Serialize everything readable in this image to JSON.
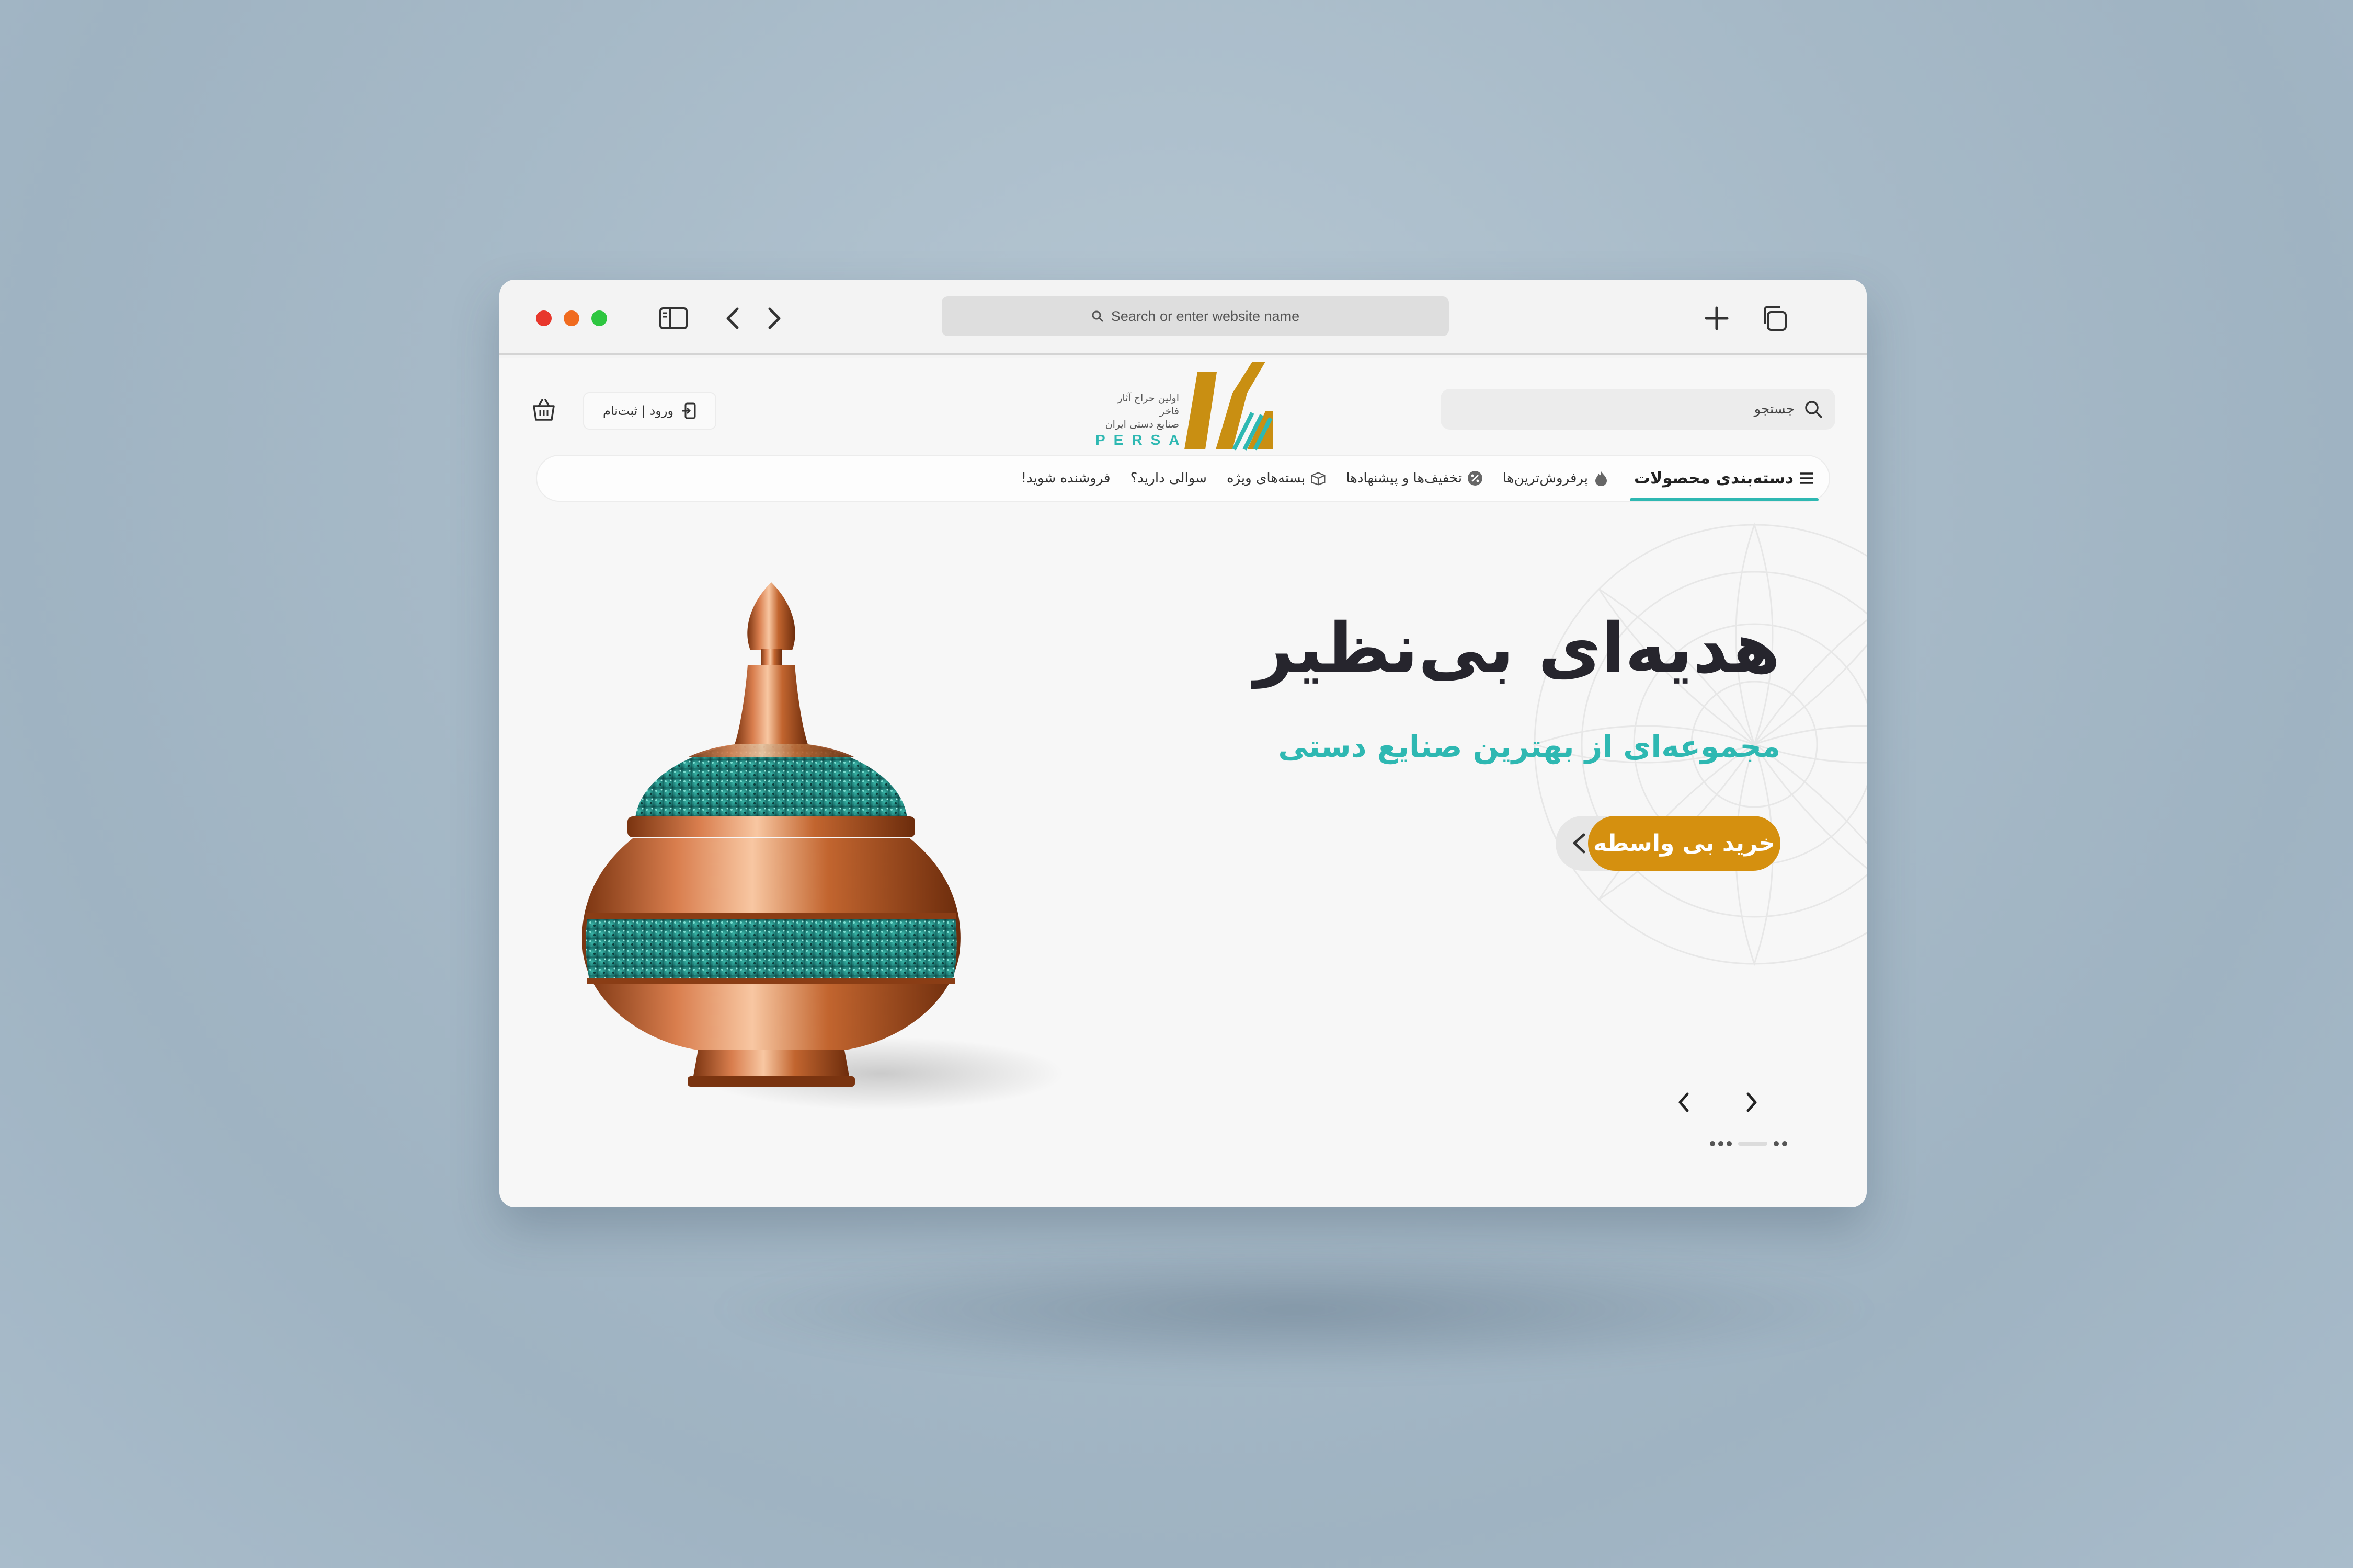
{
  "browser": {
    "url_placeholder": "Search or enter website name"
  },
  "header": {
    "login_label": "ورود | ثبت‌نام",
    "search_placeholder": "جستجو",
    "logo": {
      "tagline_line1": "اولین حراج آثار فاخر",
      "tagline_line2": "صنایع دستی ایران",
      "brand": "PERSA"
    }
  },
  "nav": {
    "categories": "دسته‌بندی محصولات",
    "items": [
      {
        "label": "پرفروش‌ترین‌ها",
        "icon": "flame-icon"
      },
      {
        "label": "تخفیف‌ها و پیشنهادها",
        "icon": "percent-icon"
      },
      {
        "label": "بسته‌های ویژه",
        "icon": "box-icon"
      },
      {
        "label": "سوالی دارید؟",
        "icon": ""
      },
      {
        "label": "فروشنده شوید!",
        "icon": ""
      }
    ]
  },
  "hero": {
    "title": "هدیه‌ای بی‌نظیر",
    "subtitle": "مجموعه‌ای از بهترین صنایع دستی",
    "cta": "خرید بی واسطه"
  },
  "colors": {
    "accent_teal": "#2eb8b2",
    "cta_gold": "#d5900f",
    "title_dark": "#26252d"
  }
}
